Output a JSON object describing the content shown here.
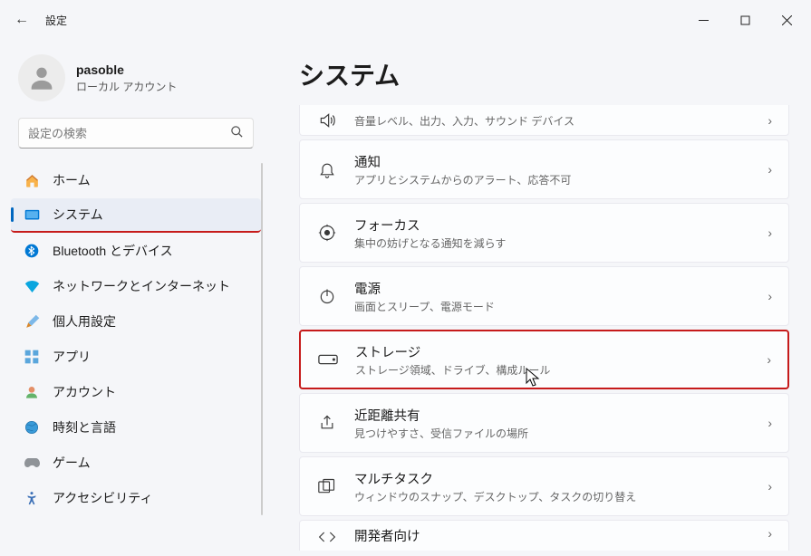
{
  "window": {
    "title": "設定",
    "back": "←"
  },
  "profile": {
    "name": "pasoble",
    "subtitle": "ローカル アカウント"
  },
  "search": {
    "placeholder": "設定の検索"
  },
  "nav": [
    {
      "icon": "home",
      "label": "ホーム"
    },
    {
      "icon": "system",
      "label": "システム"
    },
    {
      "icon": "bluetooth",
      "label": "Bluetooth とデバイス"
    },
    {
      "icon": "network",
      "label": "ネットワークとインターネット"
    },
    {
      "icon": "personalize",
      "label": "個人用設定"
    },
    {
      "icon": "apps",
      "label": "アプリ"
    },
    {
      "icon": "account",
      "label": "アカウント"
    },
    {
      "icon": "time",
      "label": "時刻と言語"
    },
    {
      "icon": "game",
      "label": "ゲーム"
    },
    {
      "icon": "accessibility",
      "label": "アクセシビリティ"
    }
  ],
  "content": {
    "title": "システム",
    "items": [
      {
        "icon": "sound",
        "title_hidden": true,
        "subtitle": "音量レベル、出力、入力、サウンド デバイス"
      },
      {
        "icon": "bell",
        "title": "通知",
        "subtitle": "アプリとシステムからのアラート、応答不可"
      },
      {
        "icon": "focus",
        "title": "フォーカス",
        "subtitle": "集中の妨げとなる通知を減らす"
      },
      {
        "icon": "power",
        "title": "電源",
        "subtitle": "画面とスリープ、電源モード"
      },
      {
        "icon": "storage",
        "title": "ストレージ",
        "subtitle": "ストレージ領域、ドライブ、構成ルール"
      },
      {
        "icon": "share",
        "title": "近距離共有",
        "subtitle": "見つけやすさ、受信ファイルの場所"
      },
      {
        "icon": "multitask",
        "title": "マルチタスク",
        "subtitle": "ウィンドウのスナップ、デスクトップ、タスクの切り替え"
      },
      {
        "icon": "dev",
        "title": "開発者向け",
        "subtitle": ""
      }
    ]
  }
}
